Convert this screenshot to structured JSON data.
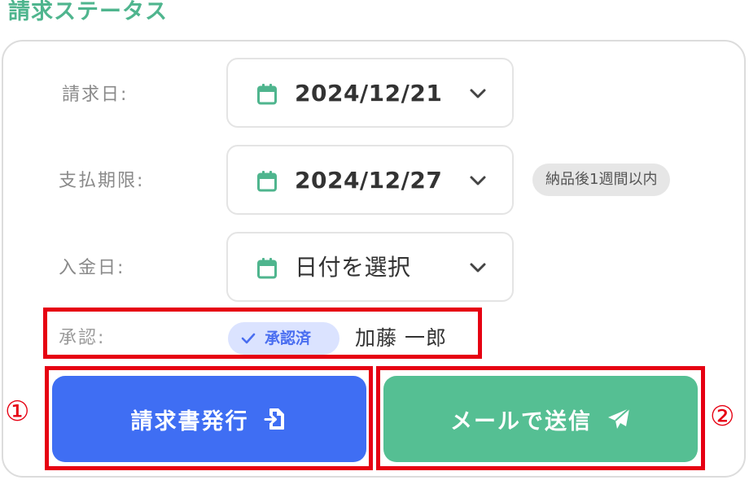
{
  "section": {
    "title": "請求ステータス"
  },
  "fields": {
    "invoice_date": {
      "label": "請求日:",
      "value": "2024/12/21"
    },
    "due_date": {
      "label": "支払期限:",
      "value": "2024/12/27",
      "note": "納品後1週間以内"
    },
    "payment_date": {
      "label": "入金日:",
      "value": "日付を選択"
    }
  },
  "approval": {
    "label": "承認:",
    "status": "承認済",
    "approver": "加藤 一郎"
  },
  "actions": {
    "issue_label": "請求書発行",
    "mail_label": "メールで送信"
  },
  "markers": {
    "first": "①",
    "second": "②"
  },
  "colors": {
    "accent_green": "#55bf93",
    "primary_blue": "#3f6ef3",
    "highlight_red": "#e60012"
  },
  "icons": {
    "calendar": "calendar-icon",
    "chevron": "chevron-down-icon",
    "check": "check-icon",
    "issue": "file-export-icon",
    "send": "paper-plane-icon"
  }
}
